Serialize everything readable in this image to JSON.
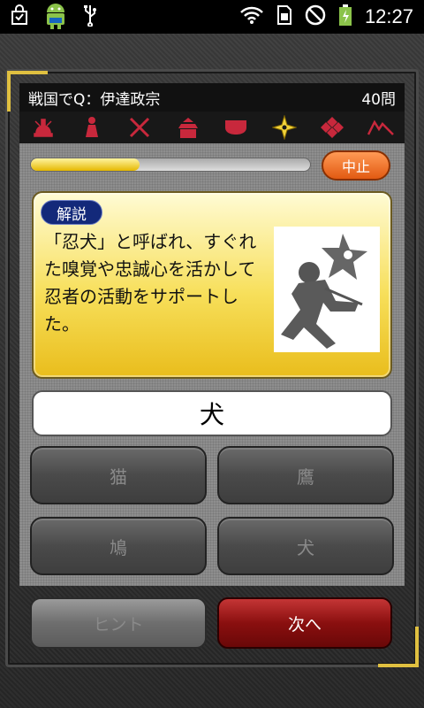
{
  "status_bar": {
    "time": "12:27",
    "icons": [
      "shopping-bag-icon",
      "android-icon",
      "usb-icon",
      "wifi-icon",
      "sim-icon",
      "no-signal-icon",
      "battery-charging-icon"
    ]
  },
  "header": {
    "title": "戦国でQ：伊達政宗",
    "question_count": "40問"
  },
  "categories": [
    "helmet-icon",
    "figure-icon",
    "crossed-swords-icon",
    "castle-icon",
    "flag-icon",
    "shuriken-icon",
    "diamond-crest-icon",
    "mountain-icon"
  ],
  "colors": {
    "accent_gold": "#e0c040",
    "category_icon": "#c8283c",
    "selected_category": "#f2d33a",
    "stop_button": "#e25a12",
    "next_button": "#8a0f0f",
    "explain_badge": "#13297a"
  },
  "progress": {
    "value": 0.39
  },
  "stop_button": {
    "label": "中止"
  },
  "explanation": {
    "badge": "解説",
    "text": "「忍犬」と呼ばれ、すぐれた嗅覚や忠誠心を活かして忍者の活動をサポートした。"
  },
  "answer": "犬",
  "choices": [
    "猫",
    "鷹",
    "鳩",
    "犬"
  ],
  "bottom": {
    "hint_label": "ヒント",
    "next_label": "次へ"
  }
}
